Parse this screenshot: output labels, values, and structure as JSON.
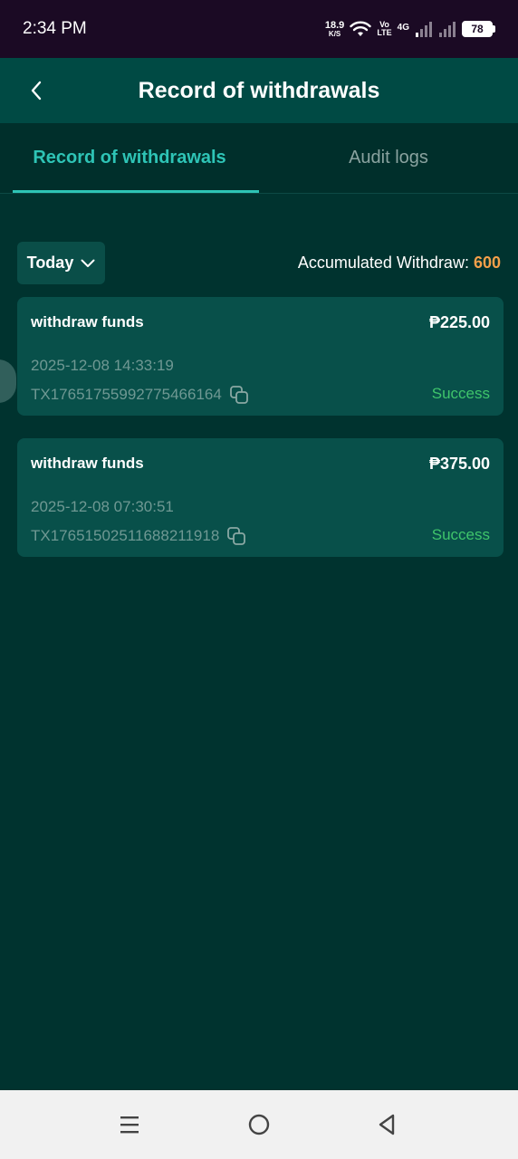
{
  "status_bar": {
    "time": "2:34 PM",
    "net_speed_value": "18.9",
    "net_speed_unit": "K/S",
    "volte_top": "Vo",
    "volte_bottom": "LTE",
    "network_type": "4G",
    "battery": "78"
  },
  "header": {
    "title": "Record of withdrawals"
  },
  "tabs": [
    {
      "label": "Record of withdrawals",
      "active": true
    },
    {
      "label": "Audit logs",
      "active": false
    }
  ],
  "filter": {
    "date_label": "Today",
    "accumulated_label": "Accumulated Withdraw: ",
    "accumulated_value": "600"
  },
  "records": [
    {
      "title": "withdraw funds",
      "amount": "₱225.00",
      "datetime": "2025-12-08 14:33:19",
      "tx_id": "TX17651755992775466164",
      "status": "Success"
    },
    {
      "title": "withdraw funds",
      "amount": "₱375.00",
      "datetime": "2025-12-08 07:30:51",
      "tx_id": "TX17651502511688211918",
      "status": "Success"
    }
  ],
  "colors": {
    "background": "#00332f",
    "header": "#004a44",
    "accent": "#2ec4b6",
    "accumulated": "#f5a04a",
    "success": "#3fc56b",
    "card": "#08504a"
  }
}
